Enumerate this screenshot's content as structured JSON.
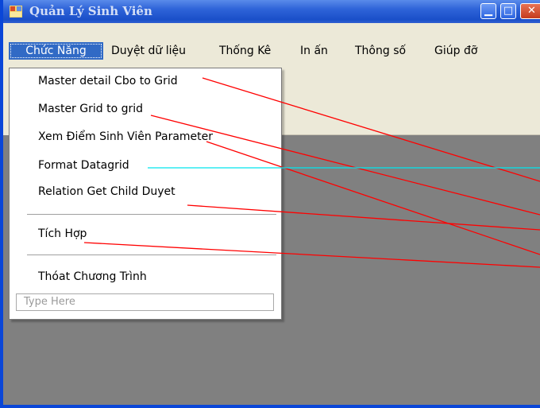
{
  "window": {
    "title": "Quản Lý Sinh Viên"
  },
  "menubar": {
    "items": [
      "Chức Năng",
      "Duyệt dữ liệu",
      "Thống Kê",
      "In ấn",
      "Thông số",
      "Giúp đỡ"
    ]
  },
  "dropdown": {
    "items": [
      "Master detail Cbo to Grid",
      "Master Grid to grid",
      "Xem Điểm Sinh Viên Parameter",
      "Format Datagrid",
      "Relation Get Child Duyet",
      "Tích Hợp",
      "Thóat Chương Trình"
    ],
    "type_here": "Type Here"
  },
  "colors": {
    "titlebar": "#2E63D8",
    "menu_highlight": "#316AC5",
    "client_area": "#808080",
    "annotation_red": "#FF0000",
    "annotation_cyan": "#00E5EE"
  }
}
